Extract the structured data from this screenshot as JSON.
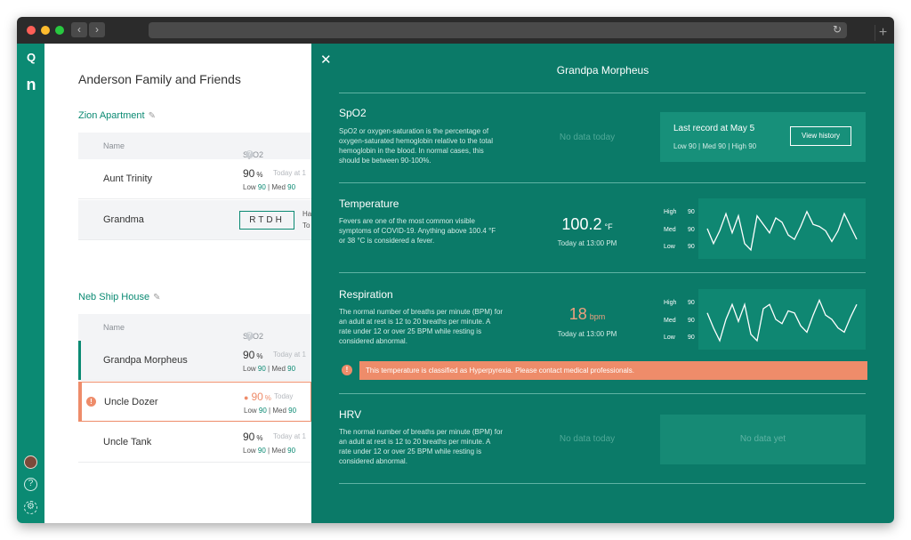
{
  "rail": {
    "logo_top": "Q",
    "logo_bottom": "n"
  },
  "list": {
    "group_title": "Anderson Family and Friends",
    "locations": [
      {
        "name": "Zion Apartment",
        "col_name": "Name",
        "col_spo2": "SpO2",
        "rows": [
          {
            "name": "Aunt Trinity",
            "value": "90",
            "unit": "%",
            "time": "Today at 1",
            "low_label": "Low",
            "low": "90",
            "med_label": "Med",
            "med": "90"
          },
          {
            "name": "Grandma",
            "code": "RTDH",
            "side_text_1": "Ha",
            "side_text_2": "To"
          }
        ]
      },
      {
        "name": "Neb Ship House",
        "col_name": "Name",
        "col_spo2": "SpO2",
        "rows": [
          {
            "name": "Grandpa Morpheus",
            "value": "90",
            "unit": "%",
            "time": "Today at 1",
            "low_label": "Low",
            "low": "90",
            "med_label": "Med",
            "med": "90"
          },
          {
            "name": "Uncle Dozer",
            "value": "90",
            "unit": "%",
            "time": "Today",
            "low_label": "Low",
            "low": "90",
            "med_label": "Med",
            "med": "90"
          },
          {
            "name": "Uncle Tank",
            "value": "90",
            "unit": "%",
            "time": "Today at 1",
            "low_label": "Low",
            "low": "90",
            "med_label": "Med",
            "med": "90"
          }
        ]
      }
    ]
  },
  "panel": {
    "title": "Grandpa Morpheus",
    "sections": {
      "spo2": {
        "title": "SpO2",
        "desc": "SpO2 or oxygen-saturation is the percentage of oxygen-saturated hemoglobin relative to the total hemoglobin in the blood. In normal cases, this should be between 90-100%.",
        "nodata": "No data today",
        "last_record": "Last record at May 5",
        "last_summary": "Low 90  |  Med 90  |  High 90",
        "history_button": "View history"
      },
      "temperature": {
        "title": "Temperature",
        "desc": "Fevers are one of the most common visible symptoms of COVID-19. Anything above 100.4 °F or 38 °C is considered a fever.",
        "value": "100.2",
        "unit": "°F",
        "time": "Today at 13:00 PM",
        "legend": [
          {
            "label": "High",
            "value": "90"
          },
          {
            "label": "Med",
            "value": "90"
          },
          {
            "label": "Low",
            "value": "90"
          }
        ],
        "sparkline": [
          0.5,
          0.15,
          0.45,
          0.85,
          0.4,
          0.8,
          0.15,
          0.0,
          0.8,
          0.6,
          0.4,
          0.75,
          0.65,
          0.35,
          0.25,
          0.55,
          0.9,
          0.6,
          0.55,
          0.45,
          0.2,
          0.45,
          0.85,
          0.55,
          0.25
        ]
      },
      "respiration": {
        "title": "Respiration",
        "desc": "The normal number of breaths per minute (BPM) for an adult at rest is 12 to 20 breaths per minute. A rate under 12 or over 25 BPM while resting is considered abnormal.",
        "value": "18",
        "unit": "bpm",
        "time": "Today at 13:00 PM",
        "legend": [
          {
            "label": "High",
            "value": "90"
          },
          {
            "label": "Med",
            "value": "90"
          },
          {
            "label": "Low",
            "value": "90"
          }
        ],
        "sparkline": [
          0.65,
          0.3,
          0.0,
          0.5,
          0.85,
          0.45,
          0.85,
          0.15,
          0.0,
          0.75,
          0.85,
          0.5,
          0.4,
          0.7,
          0.65,
          0.35,
          0.2,
          0.6,
          0.95,
          0.6,
          0.5,
          0.3,
          0.2,
          0.55,
          0.85
        ]
      },
      "alert": {
        "text": "This temperature is classified as Hyperpyrexia. Please contact medical professionals."
      },
      "hrv": {
        "title": "HRV",
        "desc": "The normal number of breaths per minute (BPM) for an adult at rest is 12 to 20 breaths per minute. A rate under 12 or over 25 BPM while resting is considered abnormal.",
        "nodata": "No data today",
        "card_nodata": "No data yet"
      }
    }
  },
  "colors": {
    "accent": "#0b8a73",
    "panel": "#0b7a68",
    "warning": "#ee8c6a"
  }
}
